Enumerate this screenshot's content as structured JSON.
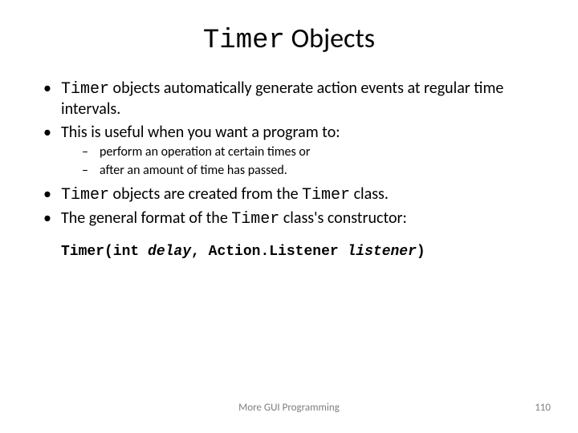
{
  "title": {
    "code": "Timer",
    "rest": " Objects"
  },
  "bullets": {
    "b1_code": "Timer",
    "b1_rest": " objects automatically generate action events at regular time intervals.",
    "b2": "This is useful when you want a program to:",
    "sub1": "perform an operation at certain times or",
    "sub2": "after an amount of time has passed.",
    "b3_code1": "Timer",
    "b3_mid": " objects are created from the ",
    "b3_code2": "Timer",
    "b3_end": " class.",
    "b4_pre": "The general format of the ",
    "b4_code": "Timer",
    "b4_post": " class's constructor:"
  },
  "code": {
    "p1": "Timer(int ",
    "arg1": "delay",
    "p2": ", Action.Listener ",
    "arg2": "listener",
    "p3": ")"
  },
  "footer": {
    "center": "More GUI Programming",
    "page": "110"
  }
}
